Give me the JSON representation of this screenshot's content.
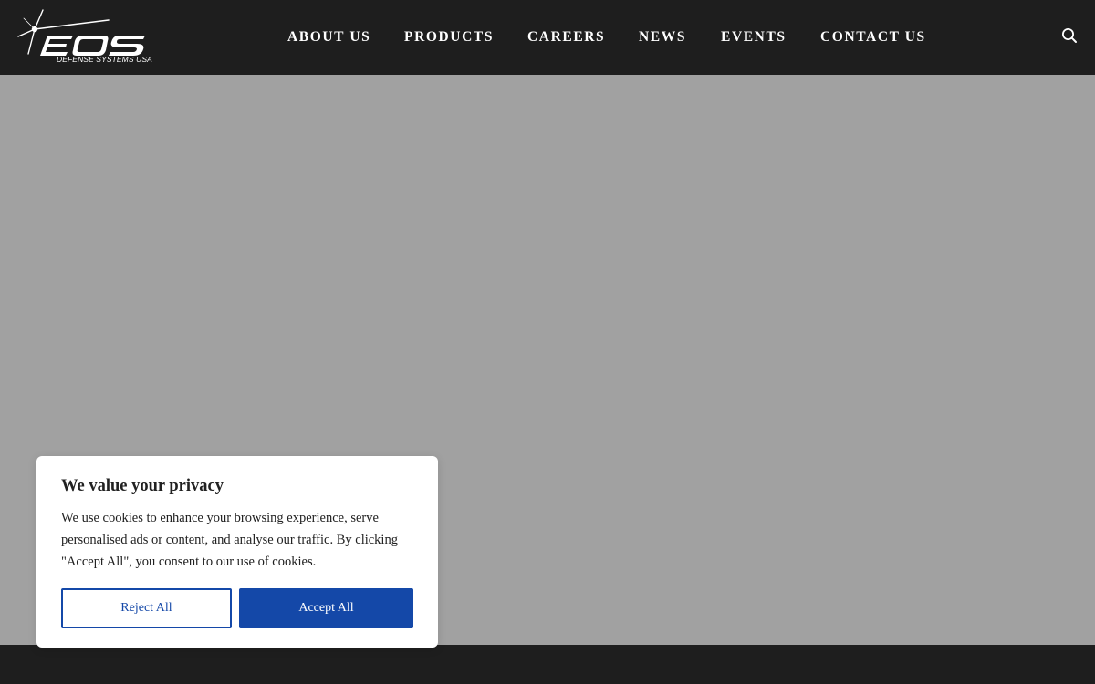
{
  "brand": {
    "logo_text": "EOS",
    "logo_subtitle": "DEFENSE SYSTEMS USA"
  },
  "nav": {
    "items": [
      {
        "label": "ABOUT US"
      },
      {
        "label": "PRODUCTS"
      },
      {
        "label": "CAREERS"
      },
      {
        "label": "NEWS"
      },
      {
        "label": "EVENTS"
      },
      {
        "label": "CONTACT US"
      }
    ],
    "search_icon": "search-icon"
  },
  "cookie_banner": {
    "title": "We value your privacy",
    "text": "We use cookies to enhance your browsing experience, serve personalised ads or content, and analyse our traffic. By clicking \"Accept All\", you consent to our use of cookies.",
    "reject_label": "Reject All",
    "accept_label": "Accept All"
  },
  "colors": {
    "header_bg": "#1e1e1e",
    "hero_bg": "#a1a1a1",
    "accent_blue": "#1448a8",
    "text_dark": "#212121"
  }
}
